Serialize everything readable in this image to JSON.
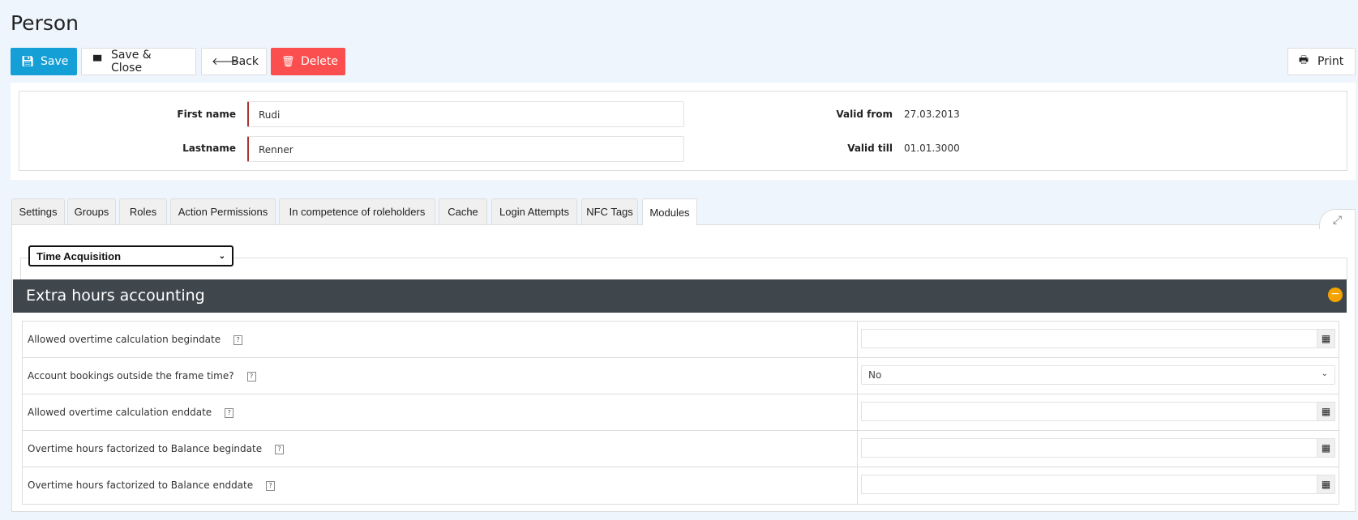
{
  "page": {
    "title": "Person"
  },
  "toolbar": {
    "save": "Save",
    "save_close": "Save & Close",
    "back": "Back",
    "delete": "Delete",
    "print": "Print"
  },
  "header": {
    "first_name_label": "First name",
    "first_name": "Rudi",
    "lastname_label": "Lastname",
    "lastname": "Renner",
    "valid_from_label": "Valid from",
    "valid_from": "27.03.2013",
    "valid_till_label": "Valid till",
    "valid_till": "01.01.3000"
  },
  "tabs": [
    "Settings",
    "Groups",
    "Roles",
    "Action Permissions",
    "In competence of roleholders",
    "Cache",
    "Login Attempts",
    "NFC Tags",
    "Modules"
  ],
  "active_tab": "Modules",
  "module_select": "Time Acquisition",
  "panel": {
    "title": "Extra hours accounting",
    "rows": [
      {
        "label": "Allowed overtime calculation begindate",
        "type": "date",
        "value": ""
      },
      {
        "label": "Account bookings outside the frame time?",
        "type": "select",
        "value": "No"
      },
      {
        "label": "Allowed overtime calculation enddate",
        "type": "date",
        "value": ""
      },
      {
        "label": "Overtime hours factorized to Balance begindate",
        "type": "date",
        "value": ""
      },
      {
        "label": "Overtime hours factorized to Balance enddate",
        "type": "date",
        "value": ""
      }
    ]
  },
  "colors": {
    "save": "#149fd6",
    "delete": "#fb4e4e",
    "panel_header": "#3f474d",
    "collapse": "#f5a300",
    "background": "#eef5fd"
  }
}
